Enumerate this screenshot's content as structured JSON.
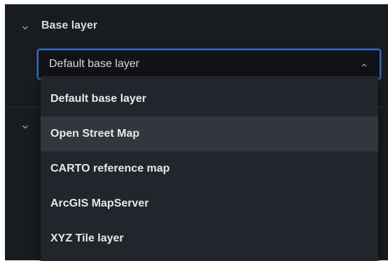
{
  "section": {
    "title": "Base layer"
  },
  "select": {
    "value": "Default base layer",
    "expanded": true
  },
  "dropdown": {
    "options": [
      "Default base layer",
      "Open Street Map",
      "CARTO reference map",
      "ArcGIS MapServer",
      "XYZ Tile layer"
    ],
    "hovered_index": 1
  },
  "colors": {
    "panel_bg": "#181b1f",
    "focus_border": "#3b6cc7",
    "dropdown_bg": "#22252b",
    "hover_bg": "#33363c",
    "text": "#d8d9da"
  }
}
